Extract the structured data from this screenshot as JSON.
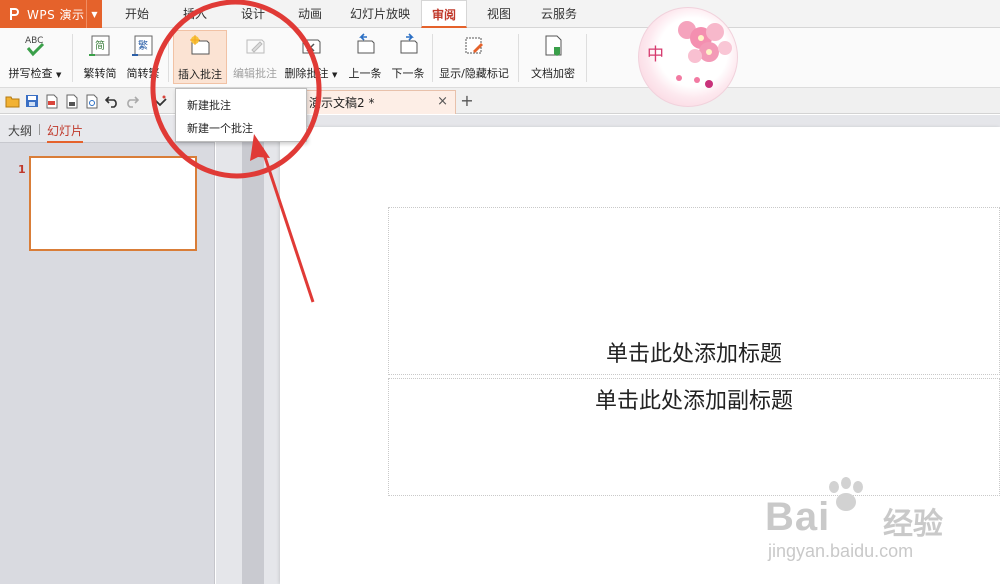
{
  "app": {
    "title": "WPS 演示"
  },
  "menu_tabs": [
    "开始",
    "插入",
    "设计",
    "动画",
    "幻灯片放映",
    "审阅",
    "视图",
    "云服务"
  ],
  "active_menu_tab": "审阅",
  "ribbon": {
    "spell_check": "拼写检查",
    "spell_icon_text": "ABC",
    "trad_to_simp": "繁转简",
    "trad_icon_char": "简",
    "simp_to_trad": "简转繁",
    "simp_icon_char": "繁",
    "insert_comment": "插入批注",
    "edit_comment": "编辑批注",
    "delete_comment": "删除批注",
    "prev_item": "上一条",
    "next_item": "下一条",
    "show_hide_markup": "显示/隐藏标记",
    "doc_encrypt": "文档加密"
  },
  "document_tab": {
    "title": "演示文稿2 *",
    "close": "×",
    "new_tab": "+"
  },
  "left_panel": {
    "tabs": [
      "大纲",
      "幻灯片"
    ],
    "active_tab": "幻灯片",
    "slide_number": "1"
  },
  "dropdown": {
    "items": [
      "新建批注",
      "新建一个批注"
    ]
  },
  "slide": {
    "title_placeholder": "单击此处添加标题",
    "subtitle_placeholder": "单击此处添加副标题"
  },
  "decoration": {
    "badge_text": "中"
  },
  "watermark": {
    "brand": "Bai",
    "cn": "经验",
    "url": "jingyan.baidu.com"
  },
  "colors": {
    "accent": "#e5622b",
    "active_tab_text": "#c0392b",
    "annotation_red": "#e03a36",
    "highlight_bg": "#fbe3d3"
  }
}
